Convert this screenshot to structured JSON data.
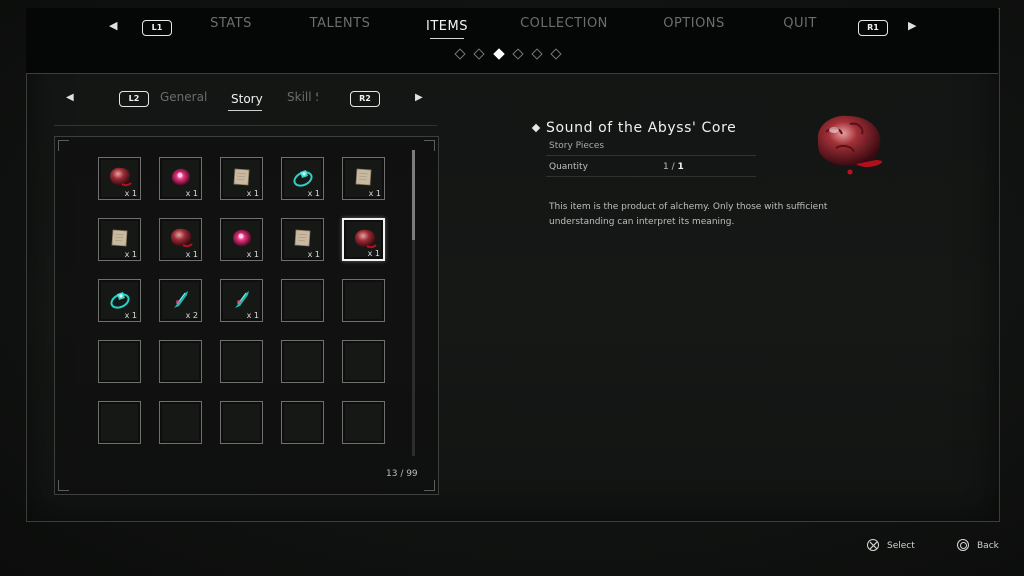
{
  "topnav": {
    "left_button": "L1",
    "right_button": "R1",
    "tabs": [
      "STATS",
      "TALENTS",
      "ITEMS",
      "COLLECTION",
      "OPTIONS",
      "QUIT"
    ],
    "active_tab": "ITEMS"
  },
  "subnav": {
    "left_button": "L2",
    "right_button": "R2",
    "tabs": [
      "General",
      "Story",
      "Skill S"
    ],
    "active_tab": "Story"
  },
  "inventory": {
    "count": "13 / 99",
    "items": [
      {
        "icon": "flesh-core-icon",
        "qty": "x 1"
      },
      {
        "icon": "pink-orb-icon",
        "qty": "x 1"
      },
      {
        "icon": "paper-scroll-icon",
        "qty": "x 1"
      },
      {
        "icon": "cyan-ring-icon",
        "qty": "x 1"
      },
      {
        "icon": "paper-scroll-icon",
        "qty": "x 1"
      },
      {
        "icon": "paper-scroll-icon",
        "qty": "x 1"
      },
      {
        "icon": "flesh-core-icon",
        "qty": "x 1"
      },
      {
        "icon": "pink-orb-icon",
        "qty": "x 1"
      },
      {
        "icon": "paper-scroll-icon",
        "qty": "x 1"
      },
      {
        "icon": "flesh-core-icon",
        "qty": "x 1"
      },
      {
        "icon": "cyan-ring-icon",
        "qty": "x 1"
      },
      {
        "icon": "teal-crystal-icon",
        "qty": "x 2"
      },
      {
        "icon": "teal-crystal-icon",
        "qty": "x 1"
      }
    ],
    "selected_index": 9
  },
  "detail": {
    "title": "Sound of the Abyss' Core",
    "category": "Story Pieces",
    "quantity_label": "Quantity",
    "quantity_have": "1",
    "quantity_max": "1",
    "description": "This item is the product of alchemy. Only those with sufficient understanding can interpret its meaning."
  },
  "footer": {
    "select_label": "Select",
    "back_label": "Back"
  }
}
